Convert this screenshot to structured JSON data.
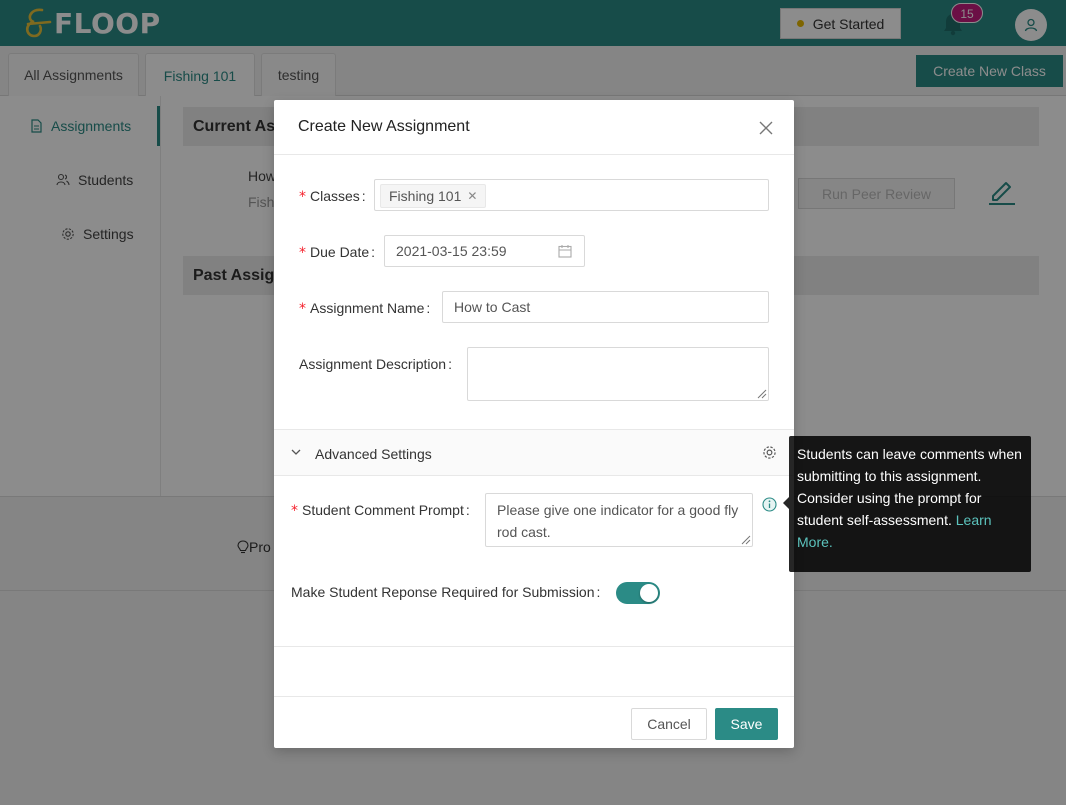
{
  "header": {
    "logo_text": "FLOOP",
    "get_started_label": "Get Started",
    "notification_count": "15",
    "colors": {
      "brand": "#2b8b86",
      "badge": "#c41d7f"
    }
  },
  "class_tabs": [
    {
      "label": "All Assignments",
      "active": false
    },
    {
      "label": "Fishing 101",
      "active": true
    },
    {
      "label": "testing",
      "active": false
    }
  ],
  "create_class_label": "Create New Class",
  "sidebar": {
    "items": [
      {
        "label": "Assignments",
        "icon": "file-icon",
        "active": true
      },
      {
        "label": "Students",
        "icon": "people-icon",
        "active": false
      },
      {
        "label": "Settings",
        "icon": "gear-icon",
        "active": false
      }
    ]
  },
  "background": {
    "current_section": "Current As",
    "past_section": "Past Assign",
    "assignment_title_fragment": "How",
    "assignment_class_fragment": "Fish",
    "run_peer_review_label": "Run Peer Review",
    "footer_fragment": "Pro"
  },
  "modal": {
    "title": "Create New Assignment",
    "classes_label": "Classes",
    "classes_tag": "Fishing 101",
    "due_date_label": "Due Date",
    "due_date_value": "2021-03-15 23:59",
    "assignment_name_label": "Assignment Name",
    "assignment_name_value": "How to Cast",
    "description_label": "Assignment Description",
    "description_value": "",
    "advanced_settings_label": "Advanced Settings",
    "comment_prompt_label": "Student Comment Prompt",
    "comment_prompt_value": "Please give one indicator for a good fly rod cast.",
    "required_response_label": "Make Student Reponse Required for Submission",
    "required_response_on": true,
    "cancel_label": "Cancel",
    "save_label": "Save"
  },
  "tooltip": {
    "text": "Students can leave comments when submitting to this assignment. Consider using the prompt for student self-assessment. ",
    "link_text": "Learn More."
  }
}
